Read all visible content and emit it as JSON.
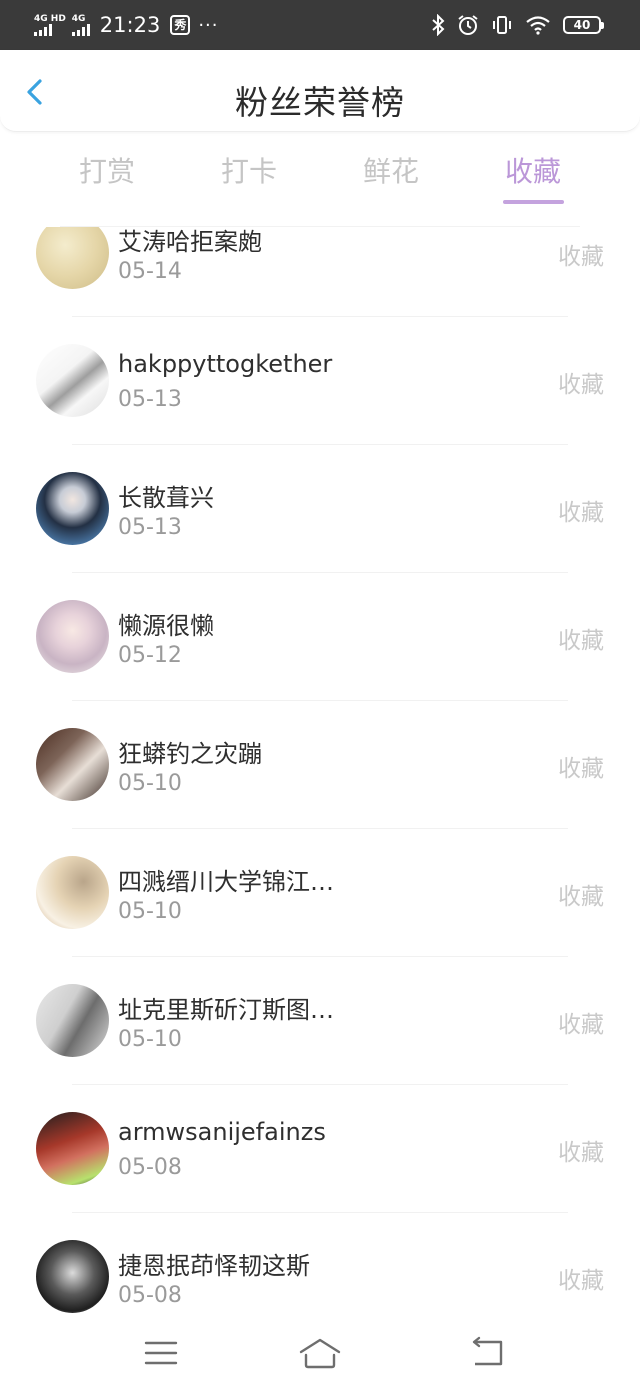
{
  "status_bar": {
    "signal1_label": "4G HD",
    "signal2_label": "4G",
    "time": "21:23",
    "app_badge": "秀",
    "dots": "···",
    "battery": "40"
  },
  "header": {
    "title": "粉丝荣誉榜"
  },
  "tabs": [
    {
      "label": "打赏"
    },
    {
      "label": "打卡"
    },
    {
      "label": "鲜花"
    },
    {
      "label": "收藏"
    }
  ],
  "active_tab": "收藏",
  "accent_color": "#bb97d8",
  "list": [
    {
      "name": "艾涛哈拒案皰",
      "date": "05-14",
      "action": "收藏"
    },
    {
      "name": "hakppyttogkether",
      "date": "05-13",
      "action": "收藏"
    },
    {
      "name": "长散葺兴",
      "date": "05-13",
      "action": "收藏"
    },
    {
      "name": "懒源很懒",
      "date": "05-12",
      "action": "收藏"
    },
    {
      "name": "狂蟒钓之灾蹦",
      "date": "05-10",
      "action": "收藏"
    },
    {
      "name": "四溅缙川大学锦江…",
      "date": "05-10",
      "action": "收藏"
    },
    {
      "name": "址克里斯斫汀斯图…",
      "date": "05-10",
      "action": "收藏"
    },
    {
      "name": "armwsanijefainzs",
      "date": "05-08",
      "action": "收藏"
    },
    {
      "name": "捷恩抿茚怿韧这斯",
      "date": "05-08",
      "action": "收藏"
    }
  ],
  "icons": {
    "back": "chevron-left-icon",
    "bluetooth": "bluetooth-icon",
    "alarm": "alarm-icon",
    "vibrate": "vibrate-icon",
    "wifi": "wifi-icon",
    "menu": "menu-icon",
    "home": "home-icon",
    "return": "back-arrow-icon"
  }
}
